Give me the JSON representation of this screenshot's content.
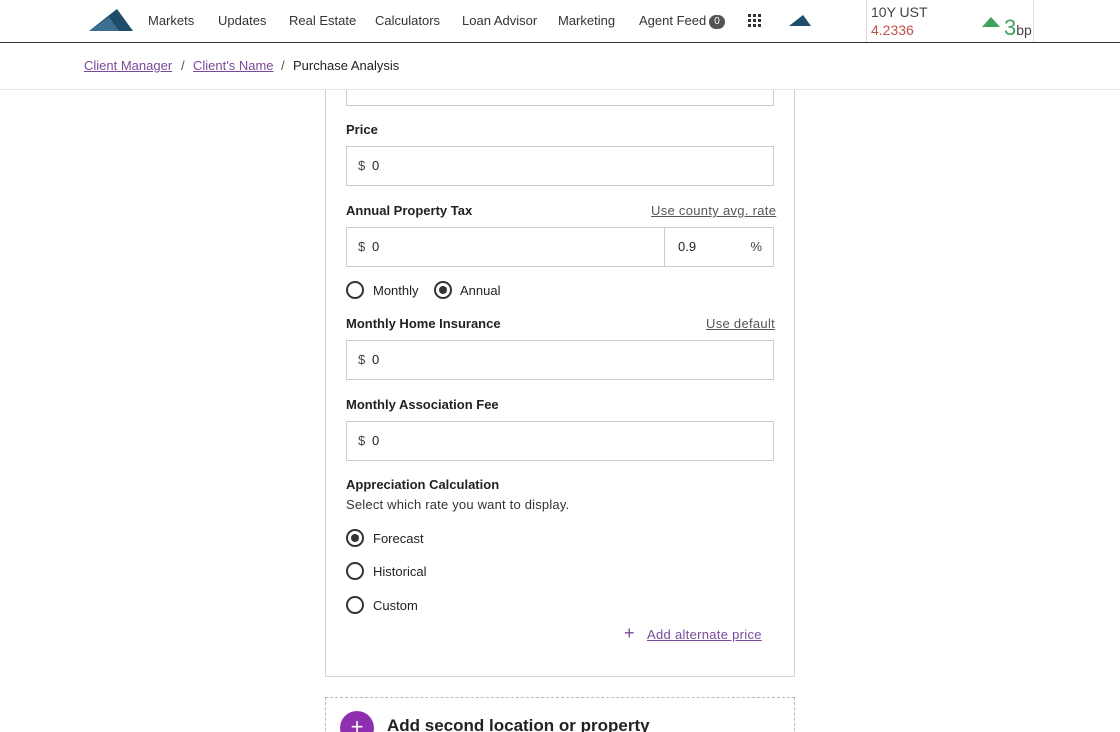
{
  "nav": {
    "items": [
      "Markets",
      "Updates",
      "Real Estate",
      "Calculators",
      "Loan Advisor",
      "Marketing",
      "Agent Feed"
    ],
    "agent_feed_count": "0"
  },
  "ticker": {
    "label": "10Y UST",
    "value": "4.2336",
    "change": "3",
    "unit": "bp",
    "direction": "up",
    "value_color": "#c0504d",
    "change_color": "#3da35a"
  },
  "breadcrumb": {
    "items": [
      "Client Manager",
      "Client's Name"
    ],
    "current": "Purchase Analysis",
    "separator": "/"
  },
  "form": {
    "price": {
      "label": "Price",
      "currency": "$",
      "value": "0"
    },
    "property_tax": {
      "label": "Annual Property Tax",
      "link": "Use county avg. rate",
      "currency": "$",
      "value": "0",
      "rate": "0.9",
      "rate_unit": "%"
    },
    "tax_period": {
      "options": [
        "Monthly",
        "Annual"
      ],
      "selected": "Annual"
    },
    "home_insurance": {
      "label": "Monthly Home Insurance",
      "link": "Use default",
      "currency": "$",
      "value": "0"
    },
    "association_fee": {
      "label": "Monthly Association Fee",
      "currency": "$",
      "value": "0"
    },
    "appreciation": {
      "label": "Appreciation Calculation",
      "helper": "Select which rate you want to display.",
      "options": [
        "Forecast",
        "Historical",
        "Custom"
      ],
      "selected": "Forecast"
    },
    "add_alternate": "Add alternate price"
  },
  "second_location": {
    "label": "Add second location or property",
    "icon": "plus-icon"
  },
  "colors": {
    "accent": "#7a4a9a",
    "primary_button": "#8e2fb0"
  }
}
